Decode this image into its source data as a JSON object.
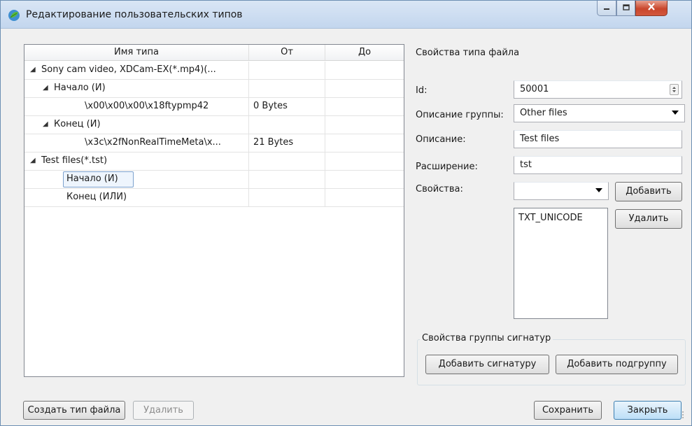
{
  "window": {
    "title": "Редактирование пользовательских типов",
    "icon": "app-leaf-icon"
  },
  "tree": {
    "headers": [
      "Имя типа",
      "От",
      "До"
    ],
    "rows": [
      {
        "name": "Sony cam video, XDCam-EX(*.mp4)(...",
        "from": "",
        "to": "",
        "expander": "expanded"
      },
      {
        "name": "Начало (И)",
        "from": "",
        "to": "",
        "expander": "expanded"
      },
      {
        "name": "\\x00\\x00\\x00\\x18ftypmp42",
        "from": "0 Bytes",
        "to": "",
        "expander": "none"
      },
      {
        "name": "Конец (И)",
        "from": "",
        "to": "",
        "expander": "expanded"
      },
      {
        "name": "\\x3c\\x2fNonRealTimeMeta\\x...",
        "from": "21 Bytes",
        "to": "",
        "expander": "none"
      },
      {
        "name": "Test files(*.tst)",
        "from": "",
        "to": "",
        "expander": "expanded"
      },
      {
        "name": "Начало (И)",
        "from": "",
        "to": "",
        "expander": "none",
        "selected": true
      },
      {
        "name": "Конец (ИЛИ)",
        "from": "",
        "to": "",
        "expander": "none"
      }
    ]
  },
  "left_buttons": {
    "create": "Создать тип файла",
    "delete": "Удалить"
  },
  "props": {
    "section_title": "Свойства типа файла",
    "id_label": "Id:",
    "id_value": "50001",
    "group_label": "Описание группы:",
    "group_value": "Other files",
    "desc_label": "Описание:",
    "desc_value": "Test files",
    "ext_label": "Расширение:",
    "ext_value": "tst",
    "attrs_label": "Свойства:",
    "attrs_value": "",
    "add_button": "Добавить",
    "remove_button": "Удалить",
    "attrs_list": [
      "TXT_UNICODE"
    ]
  },
  "signature_group": {
    "title": "Свойства группы сигнатур",
    "add_signature": "Добавить сигнатуру",
    "add_subgroup": "Добавить подгруппу"
  },
  "footer": {
    "save": "Сохранить",
    "close": "Закрыть"
  }
}
